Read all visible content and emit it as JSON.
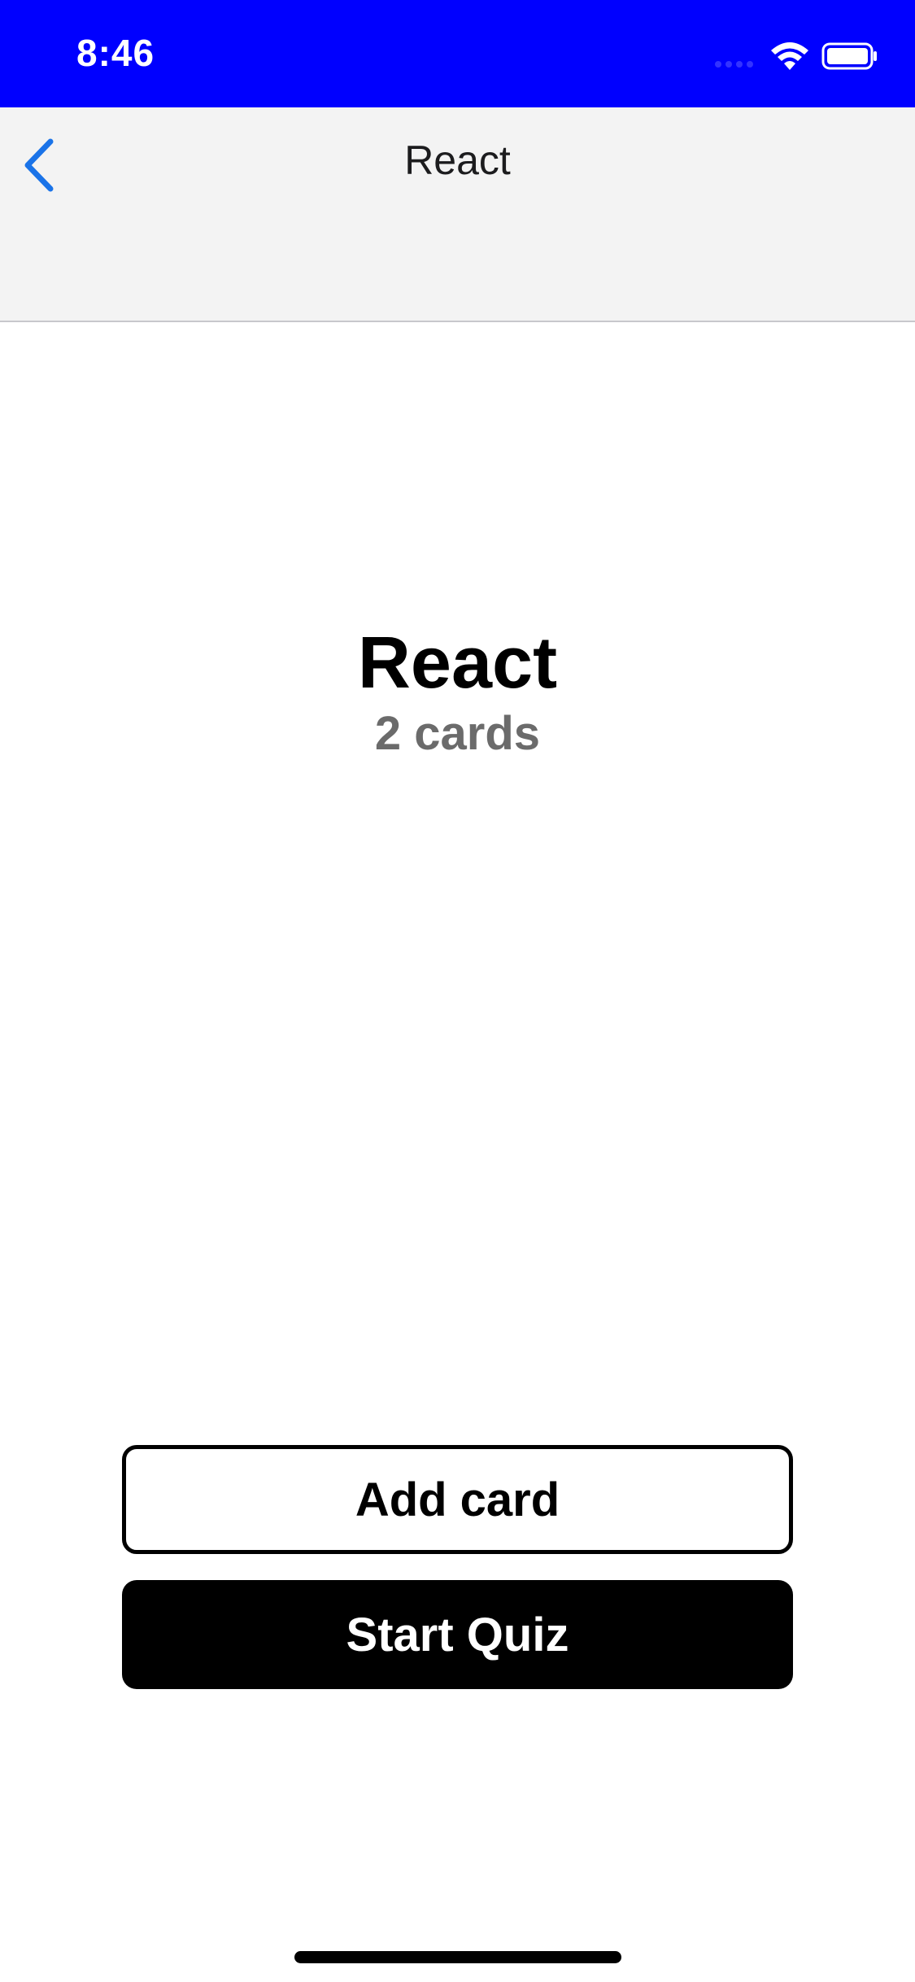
{
  "status_bar": {
    "time": "8:46",
    "background_color": "#0000ff",
    "icons": [
      "signal-icon",
      "wifi-icon",
      "battery-icon"
    ]
  },
  "nav": {
    "title": "React",
    "back_icon": "chevron-left-icon",
    "accent_color": "#1a73e8"
  },
  "deck": {
    "title": "React",
    "count_label": "2 cards"
  },
  "actions": {
    "add_card_label": "Add card",
    "start_quiz_label": "Start Quiz"
  }
}
